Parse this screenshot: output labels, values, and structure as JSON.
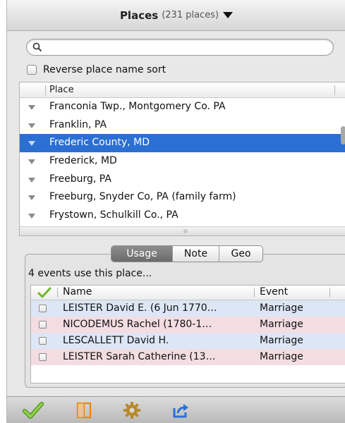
{
  "header": {
    "title": "Places",
    "count": "(231 places)"
  },
  "search": {
    "value": "",
    "placeholder": ""
  },
  "sort_option": {
    "label": "Reverse place name sort",
    "checked": false
  },
  "place_list": {
    "column_header": "Place",
    "items": [
      {
        "label": "Franconia Twp., Montgomery Co. PA",
        "selected": false
      },
      {
        "label": "Franklin, PA",
        "selected": false
      },
      {
        "label": "Frederic County, MD",
        "selected": true
      },
      {
        "label": "Frederick, MD",
        "selected": false
      },
      {
        "label": "Freeburg, PA",
        "selected": false
      },
      {
        "label": "Freeburg, Snyder Co, PA (family farm)",
        "selected": false
      },
      {
        "label": "Frystown, Schulkill Co., PA",
        "selected": false
      }
    ]
  },
  "tabs": {
    "usage": "Usage",
    "note": "Note",
    "geo": "Geo",
    "active": "Usage"
  },
  "usage": {
    "summary": "4 events use this place...",
    "columns": {
      "name": "Name",
      "event": "Event"
    },
    "rows": [
      {
        "name": "LEISTER David E. (6 Jun 1770…",
        "event": "Marriage",
        "color": "#dde6f4"
      },
      {
        "name": "NICODEMUS Rachel (1780-1…",
        "event": "Marriage",
        "color": "#f3dde2"
      },
      {
        "name": "LESCALLETT David H.",
        "event": "Marriage",
        "color": "#dde6f4"
      },
      {
        "name": "LEISTER Sarah Catherine (13…",
        "event": "Marriage",
        "color": "#f3dde2"
      }
    ]
  },
  "toolbar": {
    "icons": [
      "checkmark-icon",
      "split-view-icon",
      "gear-icon",
      "share-icon"
    ]
  },
  "colors": {
    "selection": "#2b6fd3",
    "checkmark": "#6fb52c",
    "orange_icon": "#e8860c",
    "share_icon": "#2b6fd3"
  }
}
